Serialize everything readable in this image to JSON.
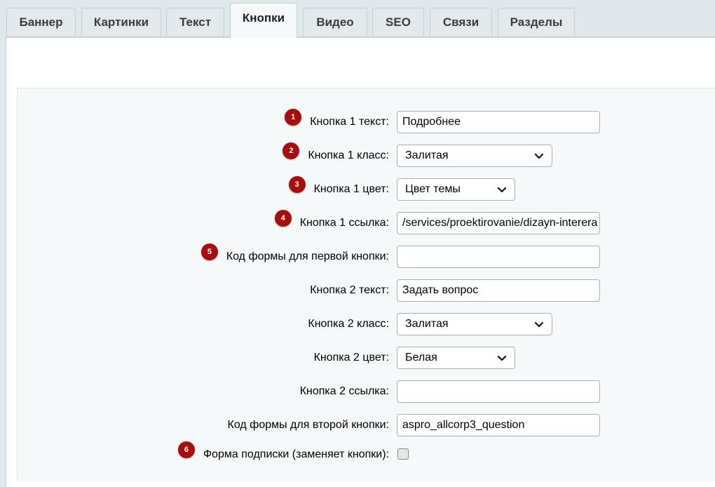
{
  "tabs": [
    {
      "label": "Баннер"
    },
    {
      "label": "Картинки"
    },
    {
      "label": "Текст"
    },
    {
      "label": "Кнопки"
    },
    {
      "label": "Видео"
    },
    {
      "label": "SEO"
    },
    {
      "label": "Связи"
    },
    {
      "label": "Разделы"
    }
  ],
  "active_tab": "Кнопки",
  "colors": {
    "badge": "#a70d0d",
    "page_bg": "#e0e8ea",
    "form_bg": "#f5f9f9"
  },
  "form": {
    "b1_text": {
      "badge": "1",
      "label": "Кнопка 1 текст:",
      "value": "Подробнее"
    },
    "b1_class": {
      "badge": "2",
      "label": "Кнопка 1 класс:",
      "value": "Залитая"
    },
    "b1_color": {
      "badge": "3",
      "label": "Кнопка 1 цвет:",
      "value": "Цвет темы"
    },
    "b1_link": {
      "badge": "4",
      "label": "Кнопка 1 ссылка:",
      "value": "/services/proektirovanie/dizayn-interera"
    },
    "b1_form": {
      "badge": "5",
      "label": "Код формы для первой кнопки:",
      "value": ""
    },
    "b2_text": {
      "label": "Кнопка 2 текст:",
      "value": "Задать вопрос"
    },
    "b2_class": {
      "label": "Кнопка 2 класс:",
      "value": "Залитая"
    },
    "b2_color": {
      "label": "Кнопка 2 цвет:",
      "value": "Белая"
    },
    "b2_link": {
      "label": "Кнопка 2 ссылка:",
      "value": ""
    },
    "b2_form": {
      "label": "Код формы для второй кнопки:",
      "value": "aspro_allcorp3_question"
    },
    "subscribe": {
      "badge": "6",
      "label": "Форма подписки (заменяет кнопки):",
      "checked": false
    }
  }
}
